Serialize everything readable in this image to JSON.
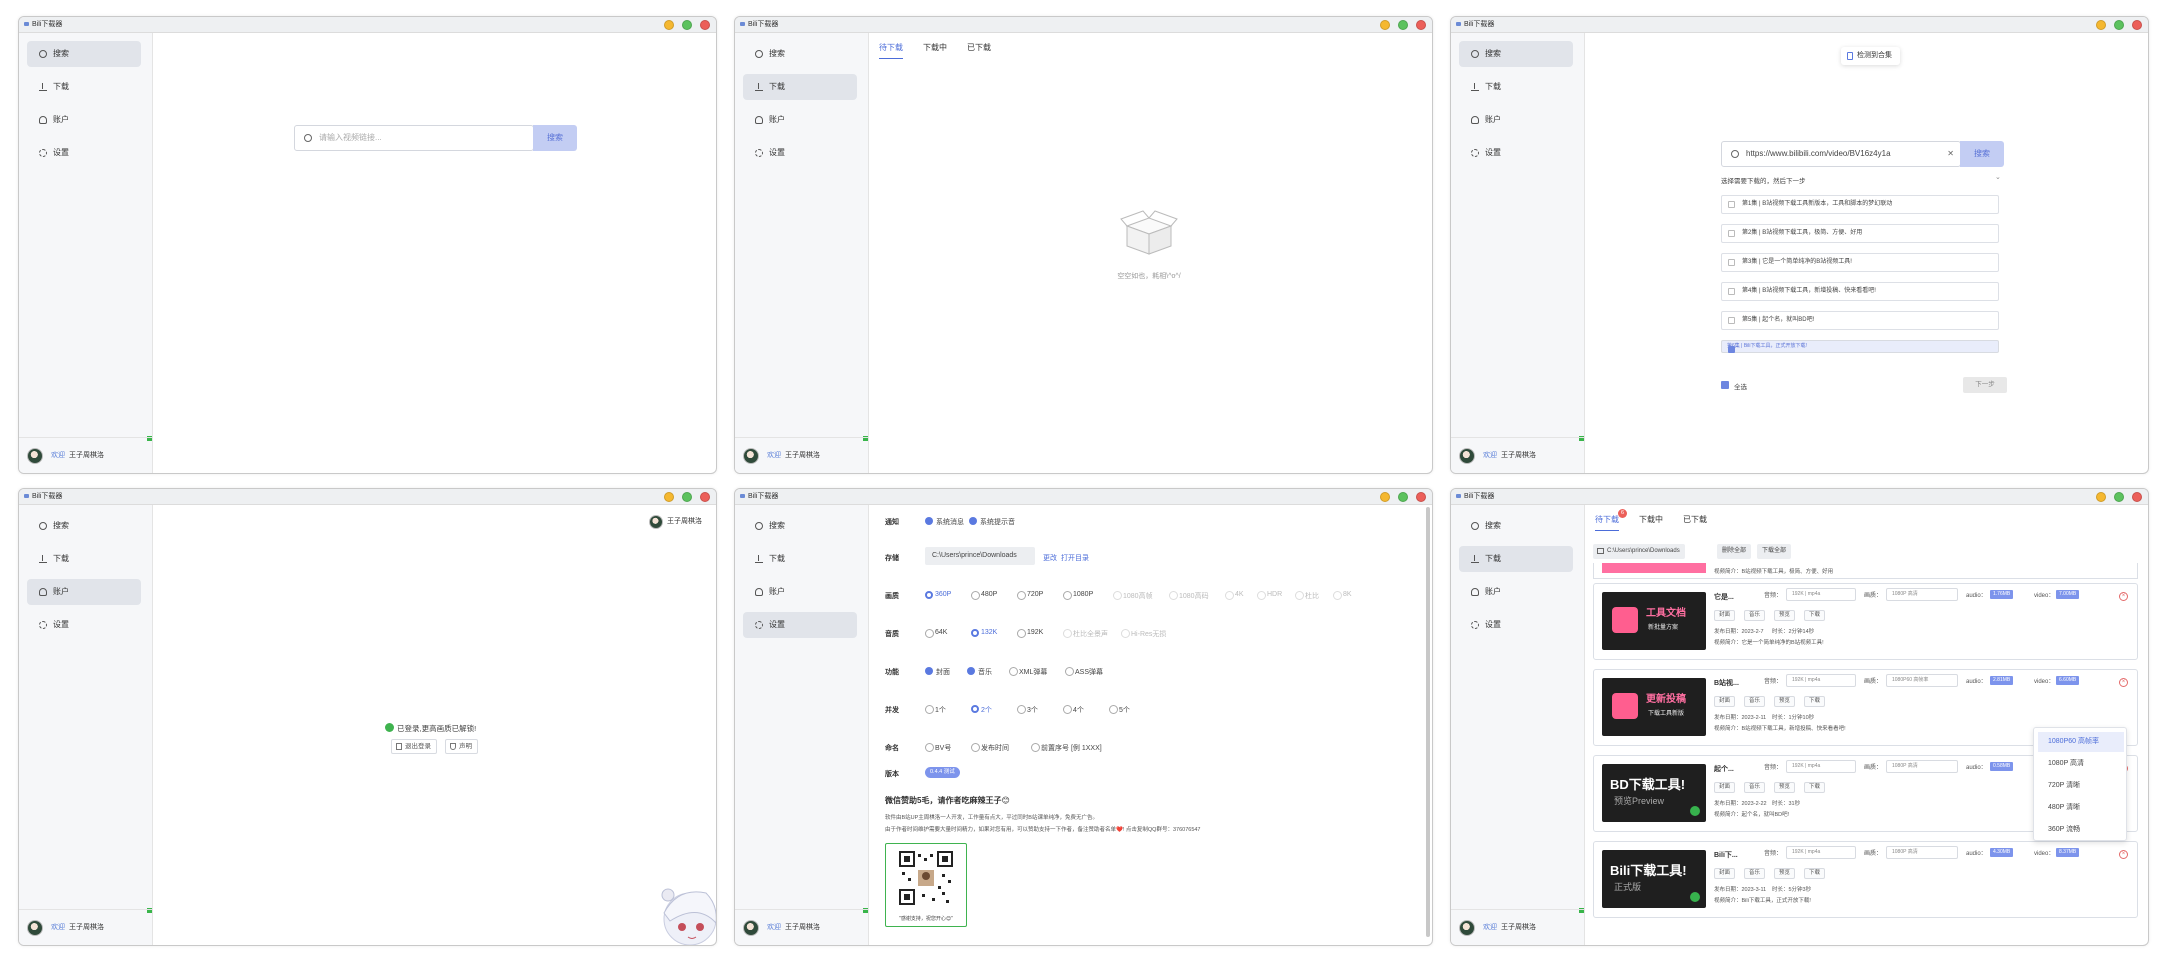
{
  "app_title": "Bili下载器",
  "nav": {
    "search": "搜索",
    "download": "下载",
    "account": "账户",
    "settings": "设置"
  },
  "footer": {
    "welcome": "欢迎",
    "username": "王子周棋洛"
  },
  "search_page": {
    "placeholder": "请输入视频链接...",
    "button": "搜索"
  },
  "download_tabs": [
    "待下载",
    "下载中",
    "已下载"
  ],
  "empty_text": "空空如也，耗相\\^o^/",
  "collection": {
    "toast": "检测到合集",
    "url_value": "https://www.bilibili.com/video/BV16z4y1a",
    "hint": "选择需要下载的，然后下一步",
    "episodes": [
      "第1集 | B站视频下载工具新版本，工具和脚本的梦幻联动",
      "第2集 | B站视频下载工具，极简、方便、好用",
      "第3集 | 它是一个简单纯净的B站视频工具!",
      "第4集 | B站视频下载工具，新增投稿、快来看看吧!",
      "第5集 | 起个名，就叫BD吧!",
      "第6集 | Bili下载工具，正式开放下载!"
    ],
    "select_all": "全选",
    "next": "下一步"
  },
  "account_page": {
    "logged_in": "已登录,更高画质已解锁!",
    "logout": "退出登录",
    "declaration": "声明",
    "username": "王子周棋洛"
  },
  "settings_page": {
    "notify_label": "通知",
    "notify_opts": [
      "系统消息",
      "系统提示音"
    ],
    "storage_label": "存储",
    "storage_path": "C:\\Users\\prince\\Downloads",
    "change": "更改",
    "open_dir": "打开目录",
    "quality_label": "画质",
    "quality_opts": [
      "360P",
      "480P",
      "720P",
      "1080P",
      "1080高帧",
      "1080高码",
      "4K",
      "HDR",
      "杜比",
      "8K"
    ],
    "audio_label": "音质",
    "audio_opts": [
      "64K",
      "132K",
      "192K",
      "杜比全景声",
      "Hi-Res无损"
    ],
    "feature_label": "功能",
    "feature_opts": [
      "封面",
      "音乐",
      "XML弹幕",
      "ASS弹幕"
    ],
    "concurrency_label": "并发",
    "concurrency_opts": [
      "1个",
      "2个",
      "3个",
      "4个",
      "5个"
    ],
    "naming_label": "命名",
    "naming_opts": [
      "BV号",
      "发布时间",
      "前置序号 [例 1XXX]"
    ],
    "version_label": "版本",
    "version_value": "0.4.4 测试",
    "donate_title": "微信赞助5毛，请作者吃麻辣王子😊",
    "donate_line1": "软件由B站UP主周棋洛一人开发，工作量有点大，平过同时B站课单纯净，免费无广告。",
    "donate_line2": "由于作者时间维护需要大量时间精力，如果对您有用，可以赞助支持一下作者，备注赞助者名单❤️! 点击复制QQ群号：376076547",
    "qr_caption": "\"感谢支持，祝您开心😊\""
  },
  "download_list": {
    "tabs": [
      "待下载",
      "下载中",
      "已下载"
    ],
    "badge": "6",
    "path": "C:\\Users\\prince\\Downloads",
    "delete_all": "删除全部",
    "download_all": "下载全部",
    "scroll_text_top": "视频简介：B站视频下载工具，极简、方便、好用",
    "items": [
      {
        "name": "它是...",
        "audio_sel": "192K | mp4a",
        "video_sel": "1080P 高清",
        "audio_size": "1.76MB",
        "video_size": "7.00MB",
        "date": "发布日期：2023-2-7",
        "dur": "时长：2分钟14秒",
        "desc": "视频简介：它是一个简单纯净的B站视频工具!",
        "thumb_title": "工具文档",
        "thumb_sub": "新批量方案",
        "kind": "pink"
      },
      {
        "name": "B站视...",
        "audio_sel": "192K | mp4a",
        "video_sel": "1080P60 高帧率",
        "audio_size": "2.81MB",
        "video_size": "6.60MB",
        "date": "发布日期：2023-2-11",
        "dur": "时长：1分钟10秒",
        "desc": "视频简介：B站视频下载工具，新增投稿、快来看看吧!",
        "thumb_title": "更新投稿",
        "thumb_sub": "下载工具新版",
        "kind": "pink"
      },
      {
        "name": "起个...",
        "audio_sel": "192K | mp4a",
        "video_sel": "1080P 高清",
        "audio_size": "0.58MB",
        "video_size": "0.99MB",
        "date": "发布日期：2023-2-22",
        "dur": "时长：31秒",
        "desc": "视频简介：起个名，就叫BD吧!",
        "thumb_title": "BD下载工具!",
        "thumb_sub": "预览Preview",
        "kind": "dark"
      },
      {
        "name": "Bili下...",
        "audio_sel": "192K | mp4a",
        "video_sel": "1080P 高清",
        "audio_size": "4.30MB",
        "video_size": "8.37MB",
        "date": "发布日期：2023-3-11",
        "dur": "时长：5分钟3秒",
        "desc": "视频简介：Bili下载工具，正式开放下载!",
        "thumb_title": "Bili下载工具!",
        "thumb_sub": "正式版",
        "kind": "dark"
      }
    ],
    "field_audio": "音频：",
    "field_video": "画质：",
    "audio_tag": "audio：",
    "video_tag": "video：",
    "actions": [
      "封面",
      "音乐",
      "预览",
      "下载"
    ],
    "quality_menu": [
      "1080P60 高帧率",
      "1080P 高清",
      "720P 清晰",
      "480P 清晰",
      "360P 流畅"
    ]
  }
}
